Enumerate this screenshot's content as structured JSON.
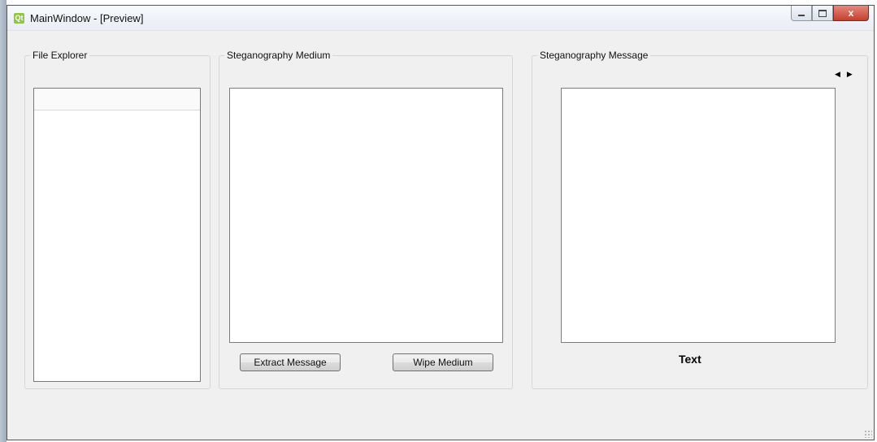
{
  "window": {
    "title": "MainWindow - [Preview]",
    "icon_text": "Qt"
  },
  "titlebar_buttons": {
    "minimize": "minimize-icon",
    "maximize": "maximize-icon",
    "close": "x"
  },
  "file_explorer": {
    "title": "File Explorer"
  },
  "medium": {
    "title": "Steganography Medium",
    "extract_label": "Extract Message",
    "wipe_label": "Wipe Medium"
  },
  "message": {
    "title": "Steganography Message",
    "prev_arrow": "◀",
    "next_arrow": "▶",
    "tab_label": "Text"
  }
}
